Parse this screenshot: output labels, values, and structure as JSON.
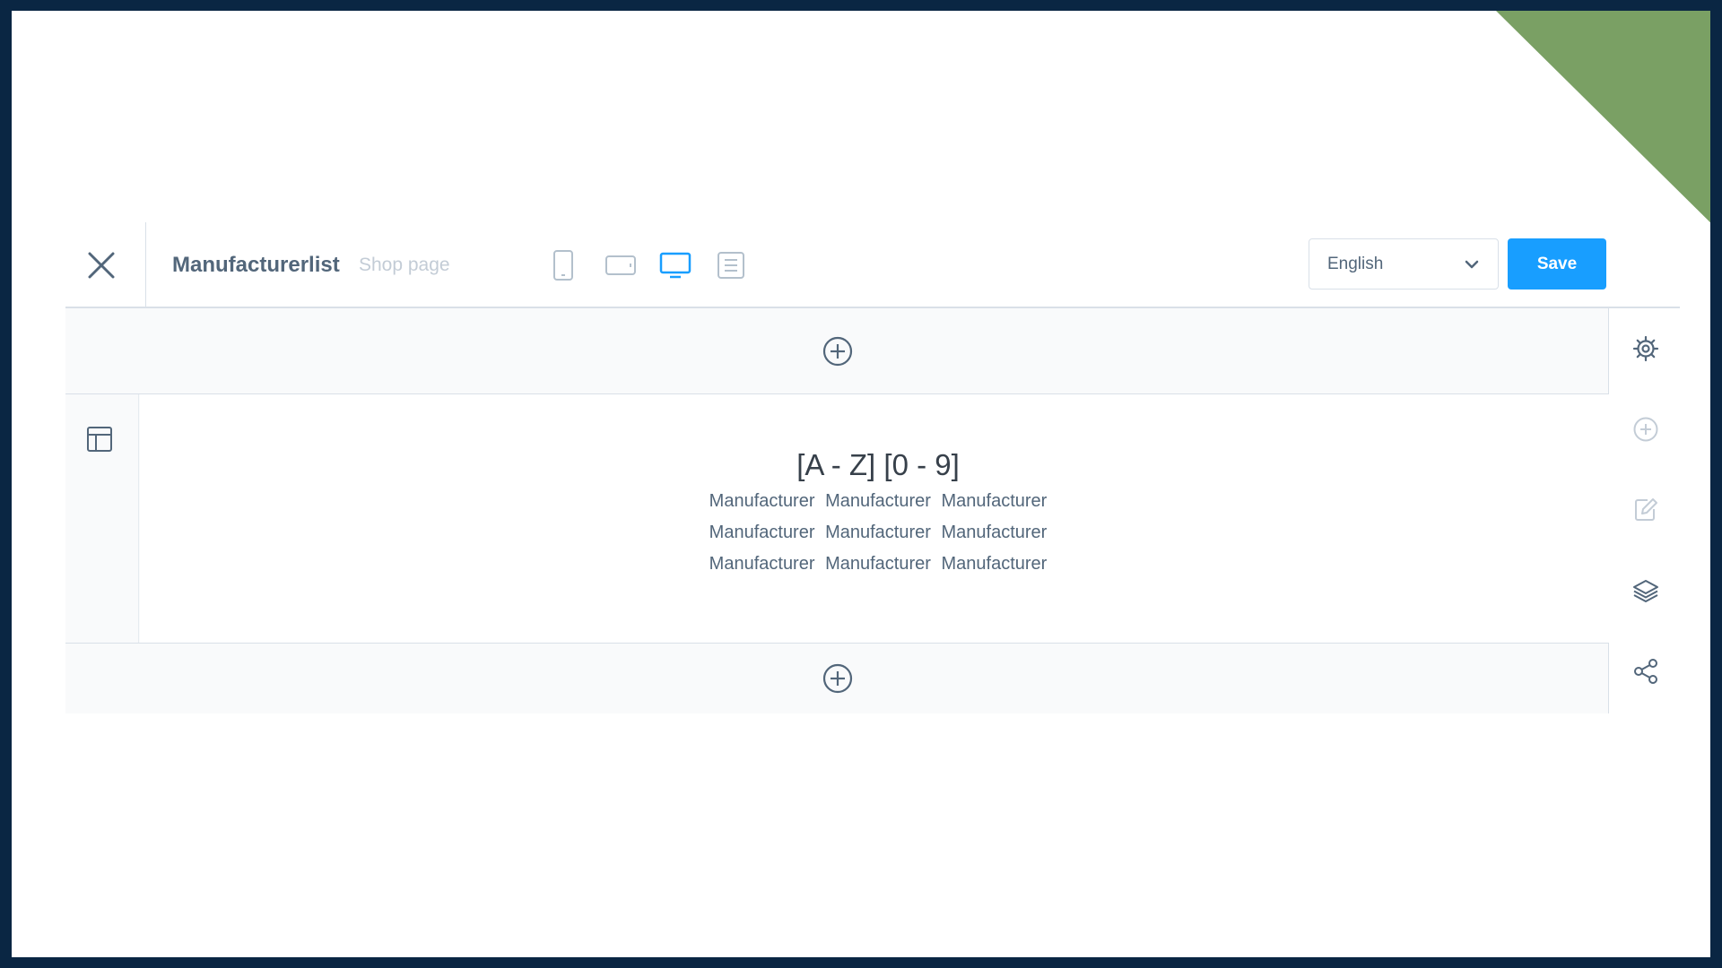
{
  "toolbar": {
    "title": "Manufacturerlist",
    "page_type": "Shop page",
    "viewports": [
      {
        "name": "mobile",
        "active": false
      },
      {
        "name": "tablet-landscape",
        "active": false
      },
      {
        "name": "desktop",
        "active": true
      },
      {
        "name": "list",
        "active": false
      }
    ],
    "language": "English",
    "save_label": "Save"
  },
  "block": {
    "heading": "[A - Z] [0 - 9]",
    "rows": [
      [
        "Manufacturer",
        "Manufacturer",
        "Manufacturer"
      ],
      [
        "Manufacturer",
        "Manufacturer",
        "Manufacturer"
      ],
      [
        "Manufacturer",
        "Manufacturer",
        "Manufacturer"
      ]
    ]
  },
  "sidebar": {
    "items": [
      "gear-icon",
      "plus-circle-icon",
      "edit-icon",
      "layers-icon",
      "share-icon"
    ]
  },
  "colors": {
    "accent": "#189eff",
    "text": "#52667a",
    "muted": "#c3ccd6",
    "frame": "#0a2643",
    "corner": "#7aa064"
  }
}
